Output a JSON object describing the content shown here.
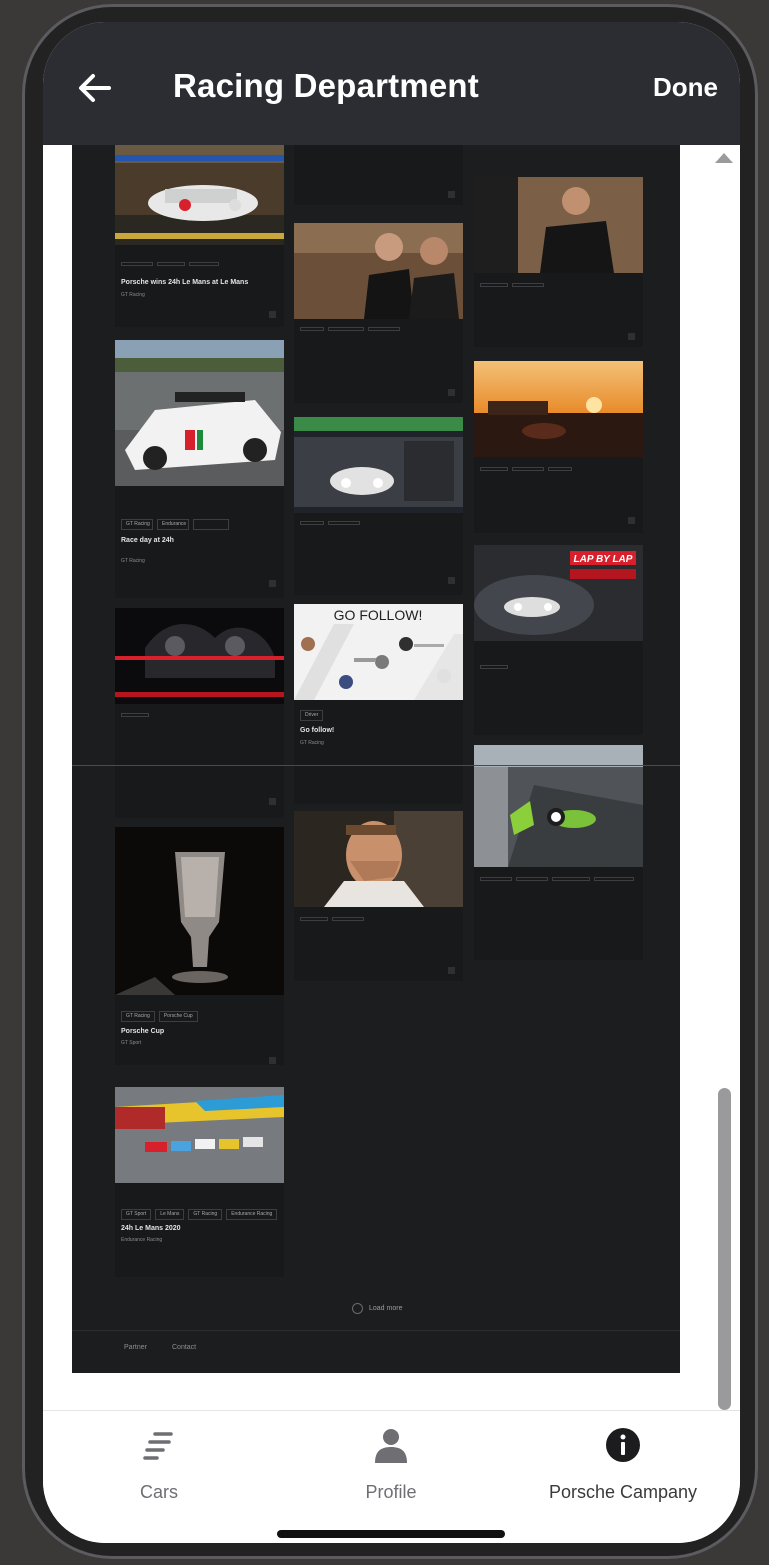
{
  "header": {
    "title": "Racing Department",
    "done_label": "Done"
  },
  "feed": {
    "cards": [
      {
        "id": "c1",
        "tags": [
          "",
          "",
          ""
        ],
        "title": "Porsche wins 24h Le Mans at Le Mans",
        "sub": "GT Racing"
      },
      {
        "id": "c2",
        "tags": [
          "",
          "",
          ""
        ],
        "title": "",
        "sub": ""
      },
      {
        "id": "c3",
        "tags": [
          "",
          "",
          ""
        ],
        "title": "",
        "sub": ""
      },
      {
        "id": "c4",
        "tags": [
          "GT Racing",
          "Endurance",
          ""
        ],
        "title": "Race day at 24h",
        "sub": "GT Racing"
      },
      {
        "id": "c5",
        "tags": [
          "",
          "",
          ""
        ],
        "title": "",
        "sub": ""
      },
      {
        "id": "c6",
        "tags": [
          "Driver",
          ""
        ],
        "title": "Go follow!",
        "sub": "GT Racing"
      },
      {
        "id": "c7",
        "tags": [
          "GT Racing",
          "Porsche Cup"
        ],
        "title": "Porsche Cup",
        "sub": "GT Sport"
      },
      {
        "id": "c8",
        "tags": [
          "GT Sport",
          "Le Mans",
          "GT Racing",
          "Endurance Racing"
        ],
        "title": "24h Le Mans 2020",
        "sub": "Endurance Racing"
      },
      {
        "id": "c9",
        "tags": [
          "",
          ""
        ],
        "title": "",
        "sub": ""
      },
      {
        "id": "c10",
        "tags": [
          "",
          ""
        ],
        "title": "",
        "sub": ""
      },
      {
        "id": "c11",
        "tags": [
          "",
          ""
        ],
        "title": "",
        "sub": ""
      },
      {
        "id": "c12",
        "tags": [
          "",
          "",
          "",
          ""
        ],
        "title": "",
        "sub": ""
      }
    ],
    "go_follow_text": "GO FOLLOW!",
    "lap_badge": "LAP BY LAP",
    "load_more": "Load more",
    "footer_links": [
      "Partner",
      "Contact"
    ]
  },
  "tabbar": {
    "items": [
      {
        "label": "Cars",
        "icon": "bars-icon"
      },
      {
        "label": "Profile",
        "icon": "person-icon"
      },
      {
        "label": "Porsche Campany",
        "icon": "info-icon"
      }
    ]
  },
  "colors": {
    "header_bg": "#2b2d33",
    "webview_bg": "#1c1d1f",
    "accent_red": "#d8202c"
  }
}
